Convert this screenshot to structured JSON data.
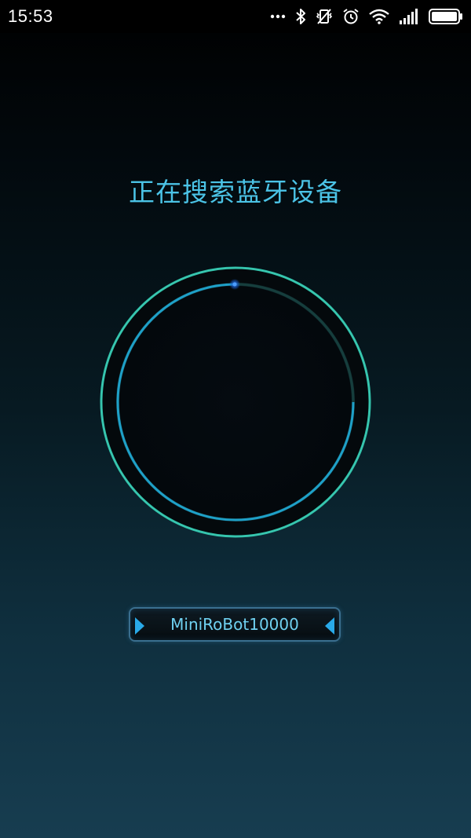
{
  "status_bar": {
    "time": "15:53",
    "icons": [
      "more-icon",
      "bluetooth-icon",
      "vibrate-icon",
      "alarm-icon",
      "wifi-icon",
      "signal-icon",
      "battery-icon"
    ]
  },
  "screen": {
    "title": "正在搜索蓝牙设备"
  },
  "scan_indicator": {
    "icon": "scanning-ring-icon"
  },
  "device_selector": {
    "device_name": "MiniRoBot10000",
    "left_icon": "arrow-left-icon",
    "right_icon": "arrow-right-icon"
  },
  "colors": {
    "accent": "#4bc3e6",
    "ring_outer": "#2fbfa8",
    "ring_inner": "#1ea0c8",
    "button_border": "#3a6f8f"
  }
}
